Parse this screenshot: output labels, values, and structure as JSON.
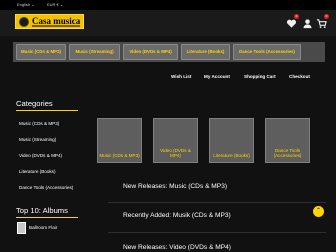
{
  "topbar": {
    "language": "English ⌄",
    "currency": "EUR € ⌄"
  },
  "logo": {
    "text": "Casa musica"
  },
  "header_icons": {
    "wishlist_count": "0",
    "cart_count": "0"
  },
  "nav": [
    "Music (CDs & MP3)",
    "Music (Streaming)",
    "Video (DVDs & MP4)",
    "Literature (Books)",
    "Dance Tools (Accessories)"
  ],
  "links": {
    "wishlist": "Wish List",
    "account": "My Account",
    "cart": "Shopping Cart",
    "checkout": "Checkout"
  },
  "sidebar": {
    "title": "Categories",
    "items": [
      "Music (CDs & MP3)",
      "Music (Streaming)",
      "Video (DVDs & MP4)",
      "Literature (Books)",
      "Dance Tools (Accessories)"
    ]
  },
  "top10": {
    "title": "Top 10: Albums",
    "first_item": "Ballroom Flair"
  },
  "tiles": [
    "Music (CDs & MP3)",
    "Video (DVDs & MP4)",
    "Literature (Books)",
    "Dance Tools (Accessories)"
  ],
  "sections": {
    "new_music": "New Releases: Music (CDs & MP3)",
    "recently_added": "Recently Added: Musik (CDs & MP3)",
    "new_video": "New Releases: Video (DVDs & MP4)"
  },
  "back_to_top": "⌃",
  "colors": {
    "accent": "#ffd400",
    "background": "#111111",
    "nav_button": "#6b6b6b"
  }
}
